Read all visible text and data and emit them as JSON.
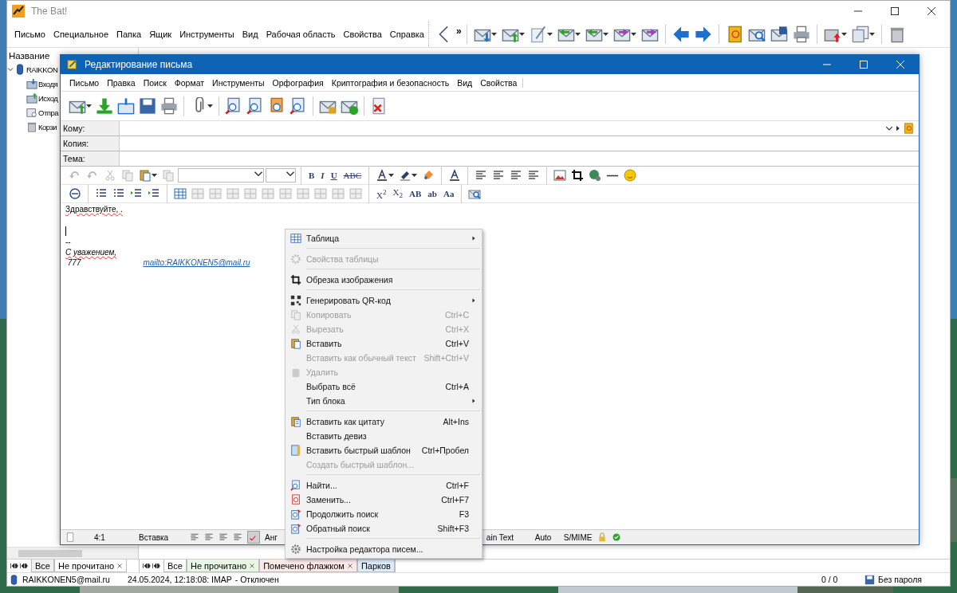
{
  "main_window": {
    "title": "The Bat!",
    "menu": [
      "Письмо",
      "Специальное",
      "Папка",
      "Ящик",
      "Инструменты",
      "Вид",
      "Рабочая область",
      "Свойства",
      "Справка"
    ],
    "toolbar_overflow": "»",
    "folder_panel": {
      "header": "Название",
      "tree": [
        {
          "label": "RAIKKON",
          "expanded": true,
          "children": [
            {
              "label": "Входя"
            },
            {
              "label": "Исход"
            },
            {
              "label": "Отпра"
            },
            {
              "label": "Корзи"
            }
          ]
        }
      ]
    },
    "left_tabs": [
      {
        "label": "Все",
        "closable": false,
        "color": "#f0f0f0"
      },
      {
        "label": "Не прочитано",
        "closable": true,
        "color": "#ffffff"
      }
    ],
    "right_tabs": [
      {
        "label": "Все",
        "closable": false,
        "color": "#ffffff"
      },
      {
        "label": "Не прочитано",
        "closable": true,
        "color": "#e8f7e4"
      },
      {
        "label": "Помечено флажком",
        "closable": true,
        "color": "#fde8e8"
      },
      {
        "label": "Парков",
        "closable": false,
        "color": "#dcecfa"
      }
    ],
    "status_bar": {
      "account": "RAIKKONEN5@mail.ru",
      "log": "24.05.2024, 12:18:08: IMAP",
      "state": "- Отключен",
      "counter": "0 / 0",
      "security": "Без пароля"
    }
  },
  "compose": {
    "title": "Редактирование письма",
    "menu": [
      "Письмо",
      "Правка",
      "Поиск",
      "Формат",
      "Инструменты",
      "Орфография",
      "Криптография и безопасность",
      "Вид",
      "Свойства"
    ],
    "fields": [
      {
        "label": "Кому:"
      },
      {
        "label": "Копия:"
      },
      {
        "label": "Тема:"
      }
    ],
    "format_text_1": [
      "B",
      "I",
      "U",
      "ABC"
    ],
    "format_text_2": [
      "X$^{2}$",
      "X$_{2}$",
      "AB",
      "ab",
      "Aa"
    ],
    "body": {
      "greeting": "Здравствуйте, .",
      "separator": "--",
      "regards": "С уважением,",
      "number": "777",
      "link": "mailto:RAIKKONEN5@mail.ru"
    },
    "status": {
      "position": "4:1",
      "mode": "Вставка",
      "language": "Анг",
      "format": "ain Text",
      "charset": "Auto",
      "crypto": "S/MIME",
      "spell_check": true
    }
  },
  "context_menu": [
    {
      "kind": "item",
      "label": "Таблица",
      "disabled": false,
      "submenu": true
    },
    {
      "kind": "separator"
    },
    {
      "kind": "item",
      "label": "Свойства таблицы",
      "disabled": true,
      "submenu": false
    },
    {
      "kind": "separator"
    },
    {
      "kind": "item",
      "label": "Обрезка изображения",
      "disabled": false,
      "submenu": false
    },
    {
      "kind": "separator"
    },
    {
      "kind": "item",
      "label": "Генерировать QR-код",
      "disabled": false,
      "submenu": true
    },
    {
      "kind": "item",
      "label": "Копировать",
      "shortcut": "Ctrl+C",
      "disabled": true,
      "submenu": false
    },
    {
      "kind": "item",
      "label": "Вырезать",
      "shortcut": "Ctrl+X",
      "disabled": true,
      "submenu": false
    },
    {
      "kind": "item",
      "label": "Вставить",
      "shortcut": "Ctrl+V",
      "disabled": false,
      "submenu": false
    },
    {
      "kind": "item",
      "label": "Вставить как обычный текст",
      "shortcut": "Shift+Ctrl+V",
      "disabled": true,
      "submenu": false
    },
    {
      "kind": "item",
      "label": "Удалить",
      "disabled": true,
      "submenu": false
    },
    {
      "kind": "item",
      "label": "Выбрать всё",
      "shortcut": "Ctrl+A",
      "disabled": false,
      "submenu": false
    },
    {
      "kind": "item",
      "label": "Тип блока",
      "disabled": false,
      "submenu": true
    },
    {
      "kind": "separator"
    },
    {
      "kind": "item",
      "label": "Вставить как цитату",
      "shortcut": "Alt+Ins",
      "disabled": false,
      "submenu": false
    },
    {
      "kind": "item",
      "label": "Вставить девиз",
      "disabled": false,
      "submenu": false
    },
    {
      "kind": "item",
      "label": "Вставить быстрый шаблон",
      "shortcut": "Ctrl+Пробел",
      "disabled": false,
      "submenu": false
    },
    {
      "kind": "item",
      "label": "Создать быстрый шаблон...",
      "disabled": true,
      "submenu": false
    },
    {
      "kind": "separator"
    },
    {
      "kind": "item",
      "label": "Найти...",
      "shortcut": "Ctrl+F",
      "disabled": false,
      "submenu": false
    },
    {
      "kind": "item",
      "label": "Заменить...",
      "shortcut": "Ctrl+F7",
      "disabled": false,
      "submenu": false
    },
    {
      "kind": "item",
      "label": "Продолжить поиск",
      "shortcut": "F3",
      "disabled": false,
      "submenu": false
    },
    {
      "kind": "item",
      "label": "Обратный поиск",
      "shortcut": "Shift+F3",
      "disabled": false,
      "submenu": false
    },
    {
      "kind": "separator"
    },
    {
      "kind": "item",
      "label": "Настройка редактора писем...",
      "disabled": false,
      "submenu": false
    }
  ]
}
